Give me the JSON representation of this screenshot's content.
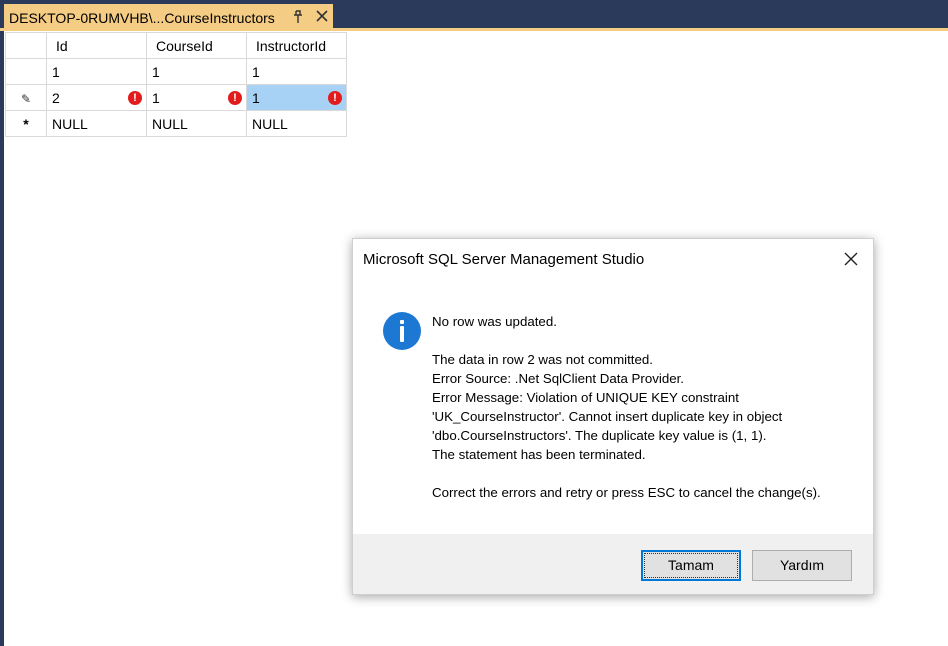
{
  "tab": {
    "title": "DESKTOP-0RUMVHB\\...CourseInstructors"
  },
  "grid": {
    "columns": [
      "Id",
      "CourseId",
      "InstructorId"
    ],
    "rows": [
      {
        "marker": "",
        "cells": [
          "1",
          "1",
          "1"
        ]
      },
      {
        "marker": "✎",
        "cells": [
          "2",
          "1",
          "1"
        ]
      },
      {
        "marker": "*",
        "cells": [
          "NULL",
          "NULL",
          "NULL"
        ]
      }
    ]
  },
  "dialog": {
    "title": "Microsoft SQL Server Management Studio",
    "lines": [
      "No row was updated.",
      "",
      "The data in row 2 was not committed.",
      "Error Source: .Net SqlClient Data Provider.",
      "Error Message: Violation of UNIQUE KEY constraint",
      "'UK_CourseInstructor'. Cannot insert duplicate key in object",
      "'dbo.CourseInstructors'. The duplicate key value is (1, 1).",
      "The statement has been terminated.",
      "",
      "Correct the errors and retry or press ESC to cancel the change(s)."
    ],
    "ok_label": "Tamam",
    "help_label": "Yardım"
  },
  "colors": {
    "accent": "#0078d7",
    "tab": "#f5cc84",
    "chrome": "#2b3a5a",
    "error": "#e21c1c",
    "info": "#1c78d2",
    "selection": "#a8d2f5"
  },
  "icons": [
    "pin-icon",
    "close-icon",
    "edit-pencil-icon",
    "new-row-icon",
    "error-icon",
    "info-icon"
  ]
}
